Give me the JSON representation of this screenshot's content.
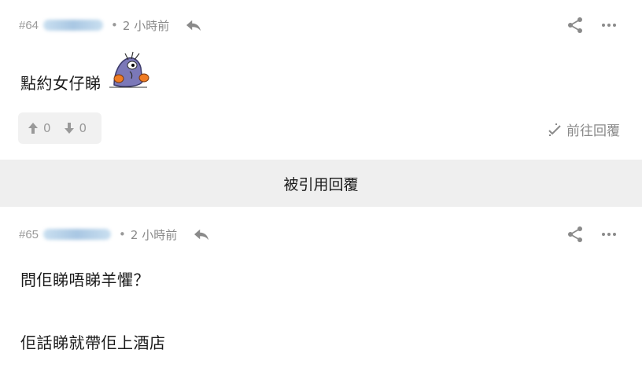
{
  "post1": {
    "floor": "#64",
    "time_sep": "•",
    "time": "2 小時前",
    "content": "點約女仔睇",
    "upvotes": "0",
    "downvotes": "0",
    "goto_label": "前往回覆"
  },
  "quote_bar": {
    "label": "被引用回覆"
  },
  "post2": {
    "floor": "#65",
    "time_sep": "•",
    "time": "2 小時前",
    "line1": "問佢睇唔睇羊懼？",
    "line2": "佢話睇就帶佢上酒店"
  },
  "icons": {
    "reply": "reply-arrow-icon",
    "share": "share-icon",
    "more": "more-dots-icon",
    "upvote": "thumb-up-arrow-icon",
    "downvote": "thumb-down-arrow-icon",
    "goto": "goto-reply-icon",
    "sticker": "cartoon-sticker"
  },
  "colors": {
    "muted": "#8a8a8a",
    "panel": "#efefef",
    "text": "#1a1a1a"
  }
}
